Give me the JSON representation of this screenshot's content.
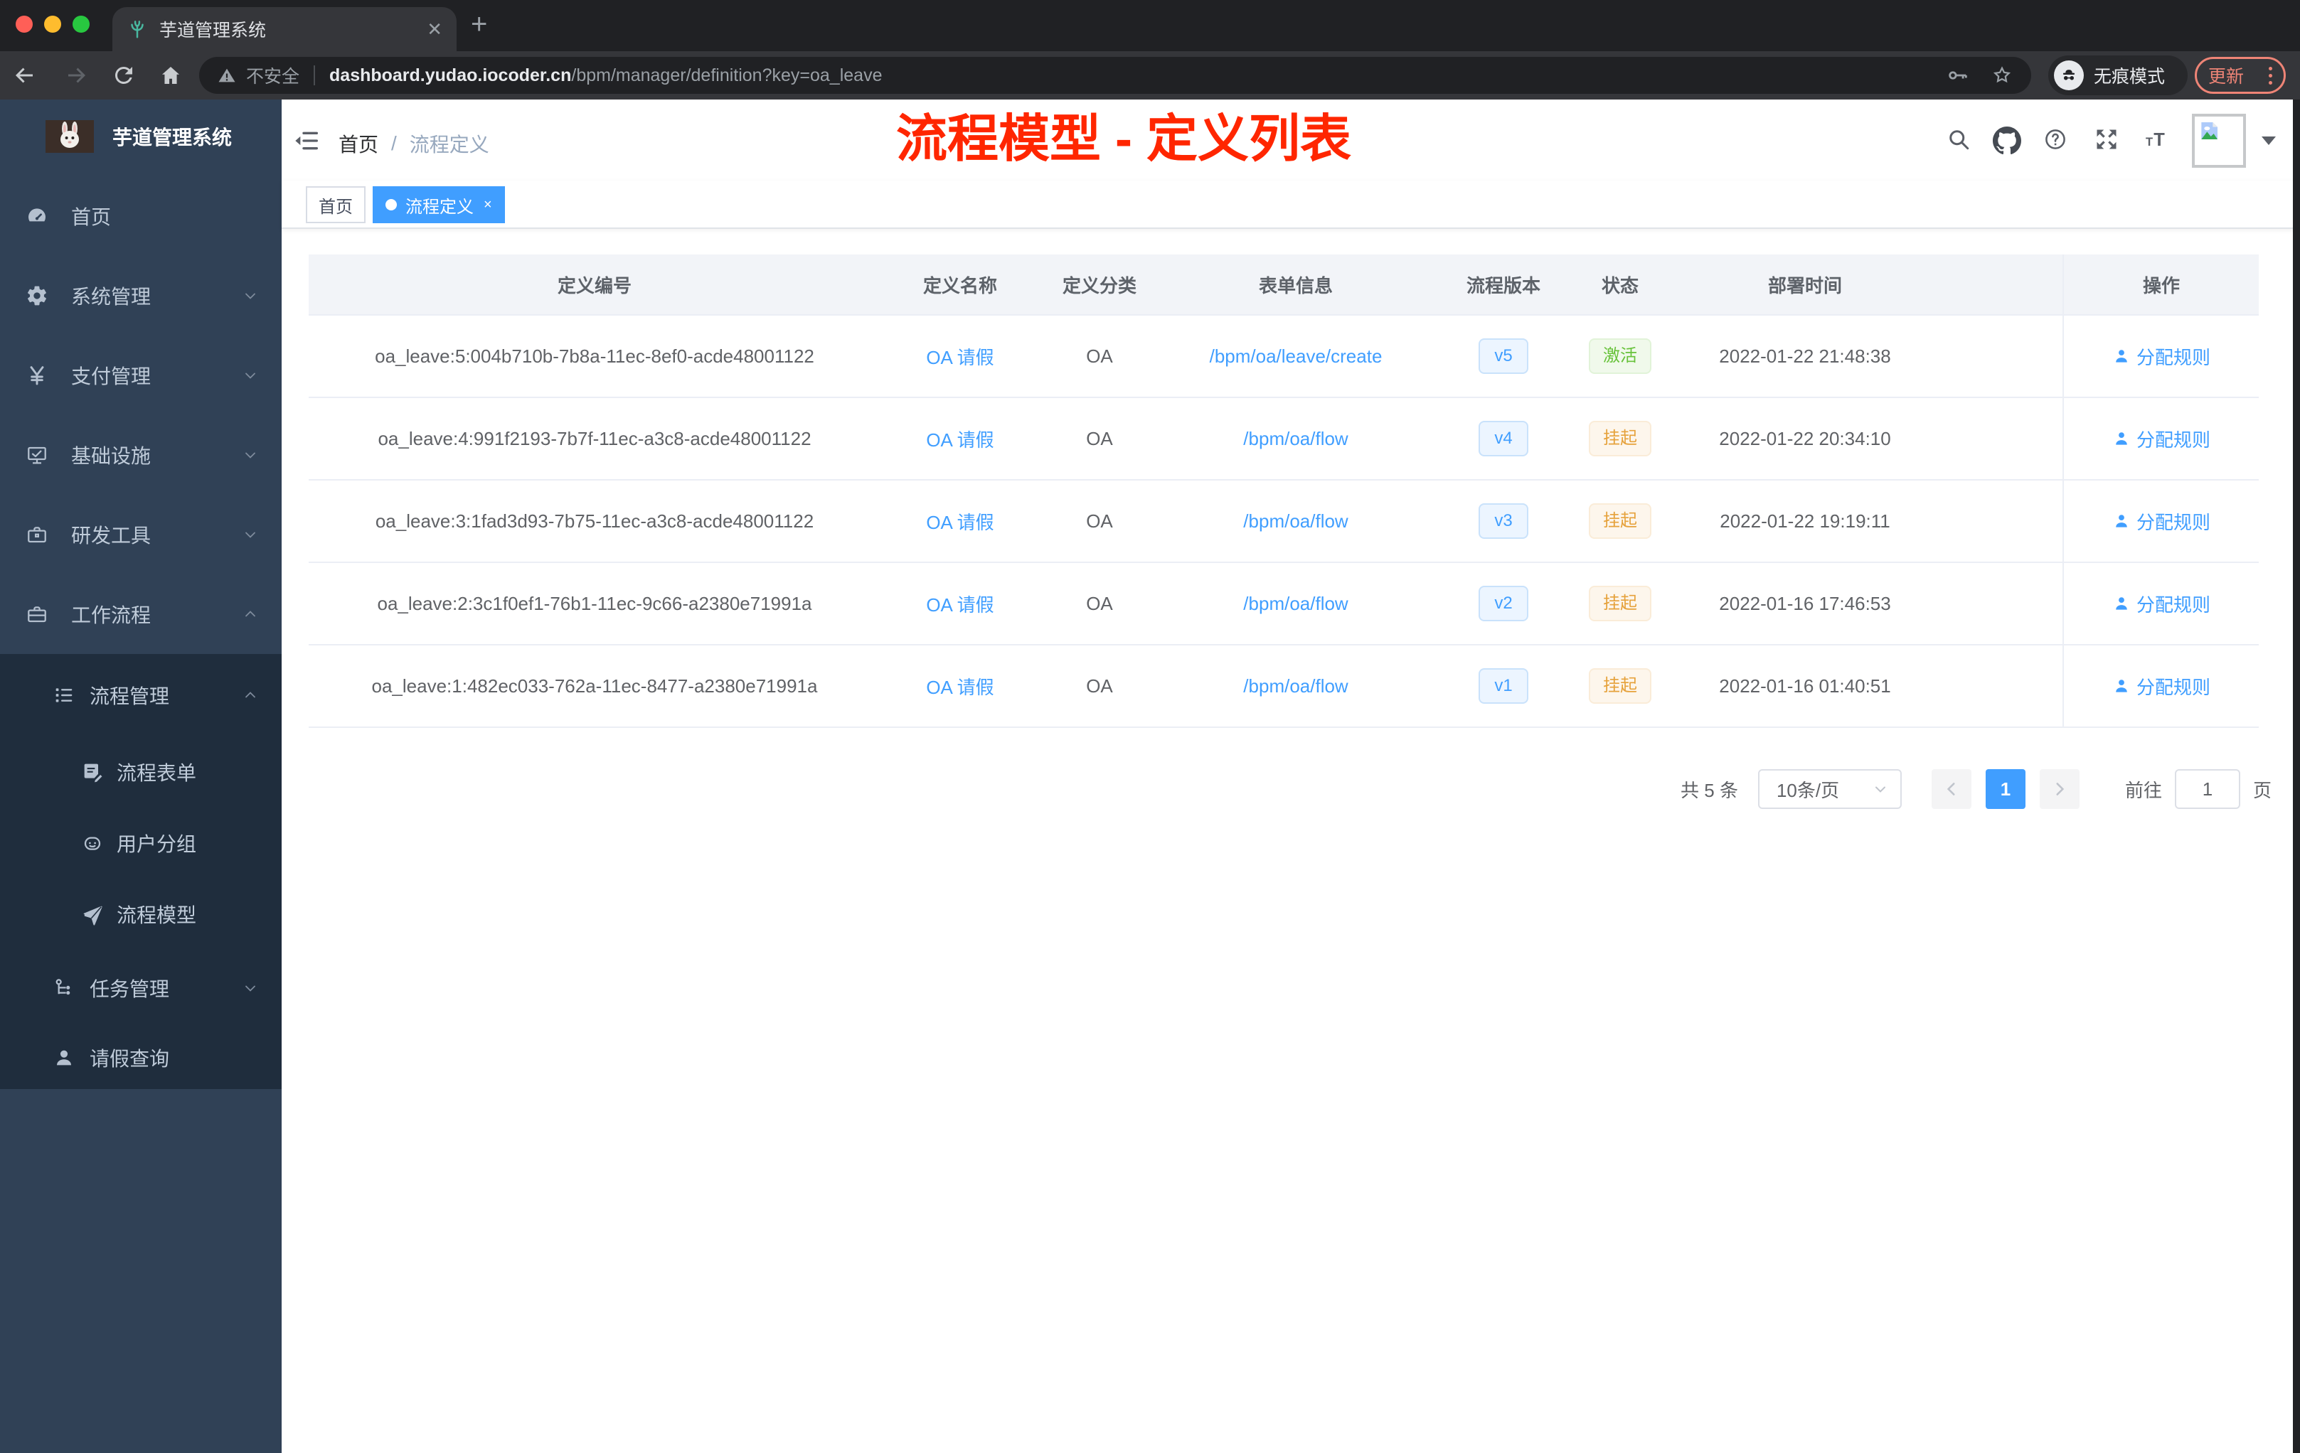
{
  "colors": {
    "accent": "#409eff",
    "success": "#67c23a",
    "warning": "#e6a23c",
    "annotation_red": "#ff2600",
    "sidebar_bg": "#304156",
    "submenu_bg": "#1f2d3d"
  },
  "browser": {
    "tab_title": "芋道管理系统",
    "security_label": "不安全",
    "url_host": "dashboard.yudao.iocoder.cn",
    "url_path": "/bpm/manager/definition?key=oa_leave",
    "incognito_label": "无痕模式",
    "update_label": "更新"
  },
  "sidebar": {
    "title": "芋道管理系统",
    "items": [
      {
        "label": "首页"
      },
      {
        "label": "系统管理"
      },
      {
        "label": "支付管理"
      },
      {
        "label": "基础设施"
      },
      {
        "label": "研发工具"
      },
      {
        "label": "工作流程"
      },
      {
        "label": "流程管理"
      },
      {
        "label": "流程表单"
      },
      {
        "label": "用户分组"
      },
      {
        "label": "流程模型"
      },
      {
        "label": "任务管理"
      },
      {
        "label": "请假查询"
      }
    ]
  },
  "navbar": {
    "breadcrumb_home": "首页",
    "breadcrumb_sep": "/",
    "breadcrumb_current": "流程定义"
  },
  "annotation": {
    "text": "流程模型 - 定义列表"
  },
  "tags": {
    "home": "首页",
    "active": "流程定义",
    "close": "×"
  },
  "table": {
    "columns": [
      "定义编号",
      "定义名称",
      "定义分类",
      "表单信息",
      "流程版本",
      "状态",
      "部署时间",
      "操作"
    ],
    "rows": [
      {
        "id": "oa_leave:5:004b710b-7b8a-11ec-8ef0-acde48001122",
        "name": "OA 请假",
        "category": "OA",
        "form": "/bpm/oa/leave/create",
        "version": "v5",
        "status": "激活",
        "time": "2022-01-22 21:48:38",
        "action": "分配规则"
      },
      {
        "id": "oa_leave:4:991f2193-7b7f-11ec-a3c8-acde48001122",
        "name": "OA 请假",
        "category": "OA",
        "form": "/bpm/oa/flow",
        "version": "v4",
        "status": "挂起",
        "time": "2022-01-22 20:34:10",
        "action": "分配规则"
      },
      {
        "id": "oa_leave:3:1fad3d93-7b75-11ec-a3c8-acde48001122",
        "name": "OA 请假",
        "category": "OA",
        "form": "/bpm/oa/flow",
        "version": "v3",
        "status": "挂起",
        "time": "2022-01-22 19:19:11",
        "action": "分配规则"
      },
      {
        "id": "oa_leave:2:3c1f0ef1-76b1-11ec-9c66-a2380e71991a",
        "name": "OA 请假",
        "category": "OA",
        "form": "/bpm/oa/flow",
        "version": "v2",
        "status": "挂起",
        "time": "2022-01-16 17:46:53",
        "action": "分配规则"
      },
      {
        "id": "oa_leave:1:482ec033-762a-11ec-8477-a2380e71991a",
        "name": "OA 请假",
        "category": "OA",
        "form": "/bpm/oa/flow",
        "version": "v1",
        "status": "挂起",
        "time": "2022-01-16 01:40:51",
        "action": "分配规则"
      }
    ]
  },
  "pagination": {
    "total": "共 5 条",
    "page_size": "10条/页",
    "page": "1",
    "goto": "前往",
    "goto_value": "1",
    "unit": "页"
  }
}
